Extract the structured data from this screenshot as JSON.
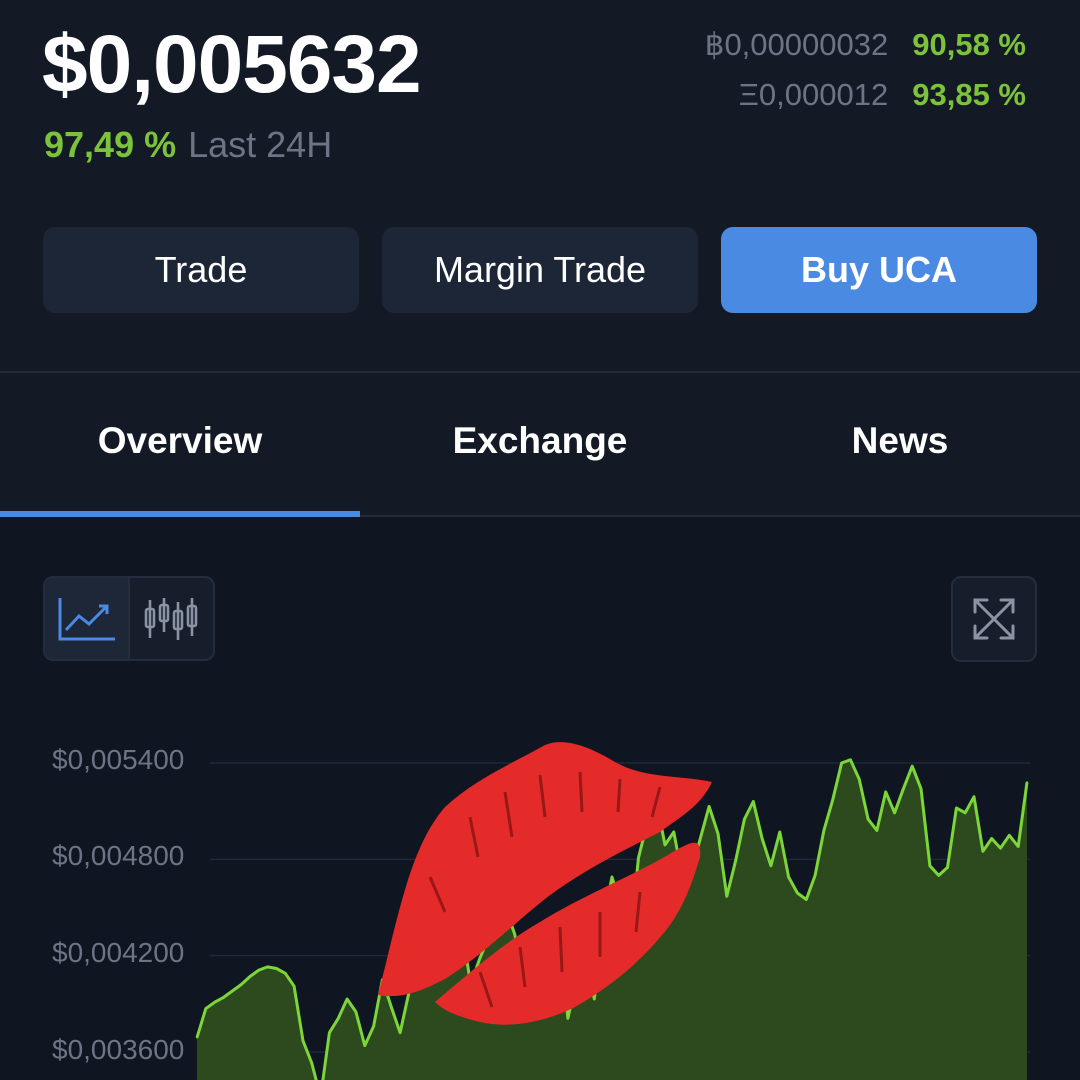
{
  "header": {
    "price": "$0,005632",
    "change_pct": "97,49 %",
    "change_label": "Last 24H",
    "btc_value": "฿0,00000032",
    "btc_change": "90,58 %",
    "eth_value": "Ξ0,000012",
    "eth_change": "93,85 %"
  },
  "actions": {
    "trade": "Trade",
    "margin_trade": "Margin Trade",
    "buy": "Buy UCA"
  },
  "tabs": [
    {
      "label": "Overview",
      "active": true
    },
    {
      "label": "Exchange",
      "active": false
    },
    {
      "label": "News",
      "active": false
    }
  ],
  "chart_controls": {
    "line_icon": "line-chart-icon",
    "candle_icon": "candlestick-icon",
    "expand_icon": "expand-icon",
    "active_mode": "line"
  },
  "colors": {
    "accent": "#4a8ae3",
    "positive": "#7cc23a",
    "line": "#7cd63a",
    "fill": "#2d4a1e"
  },
  "overlay": {
    "sticker": "lips-sticker"
  },
  "chart_data": {
    "type": "area",
    "yticks": [
      "$0,005400",
      "$0,004800",
      "$0,004200",
      "$0,003600"
    ],
    "ylim": [
      0.0033,
      0.0059
    ],
    "grid": true,
    "y": [
      0.00369,
      0.00387,
      0.00391,
      0.00394,
      0.00398,
      0.00402,
      0.00407,
      0.00411,
      0.00413,
      0.00412,
      0.00409,
      0.00401,
      0.00367,
      0.00353,
      0.00332,
      0.00372,
      0.00381,
      0.00393,
      0.00385,
      0.00364,
      0.00376,
      0.00405,
      0.00388,
      0.00372,
      0.00397,
      0.00441,
      0.00466,
      0.00412,
      0.00426,
      0.00453,
      0.00437,
      0.00402,
      0.00418,
      0.00431,
      0.00447,
      0.00449,
      0.00433,
      0.00391,
      0.00417,
      0.00386,
      0.00392,
      0.00433,
      0.00381,
      0.00406,
      0.00423,
      0.00393,
      0.00441,
      0.00469,
      0.00451,
      0.00427,
      0.00481,
      0.00503,
      0.00517,
      0.00489,
      0.00497,
      0.00468,
      0.00473,
      0.00493,
      0.00513,
      0.00496,
      0.00457,
      0.00479,
      0.00505,
      0.00516,
      0.00493,
      0.00476,
      0.00497,
      0.00469,
      0.00459,
      0.00455,
      0.0047,
      0.00498,
      0.00517,
      0.0054,
      0.00542,
      0.0053,
      0.00505,
      0.00498,
      0.00522,
      0.00509,
      0.00524,
      0.00538,
      0.00524,
      0.00476,
      0.0047,
      0.00475,
      0.00512,
      0.00509,
      0.00519,
      0.00485,
      0.00493,
      0.00487,
      0.00495,
      0.00488,
      0.00528
    ]
  }
}
